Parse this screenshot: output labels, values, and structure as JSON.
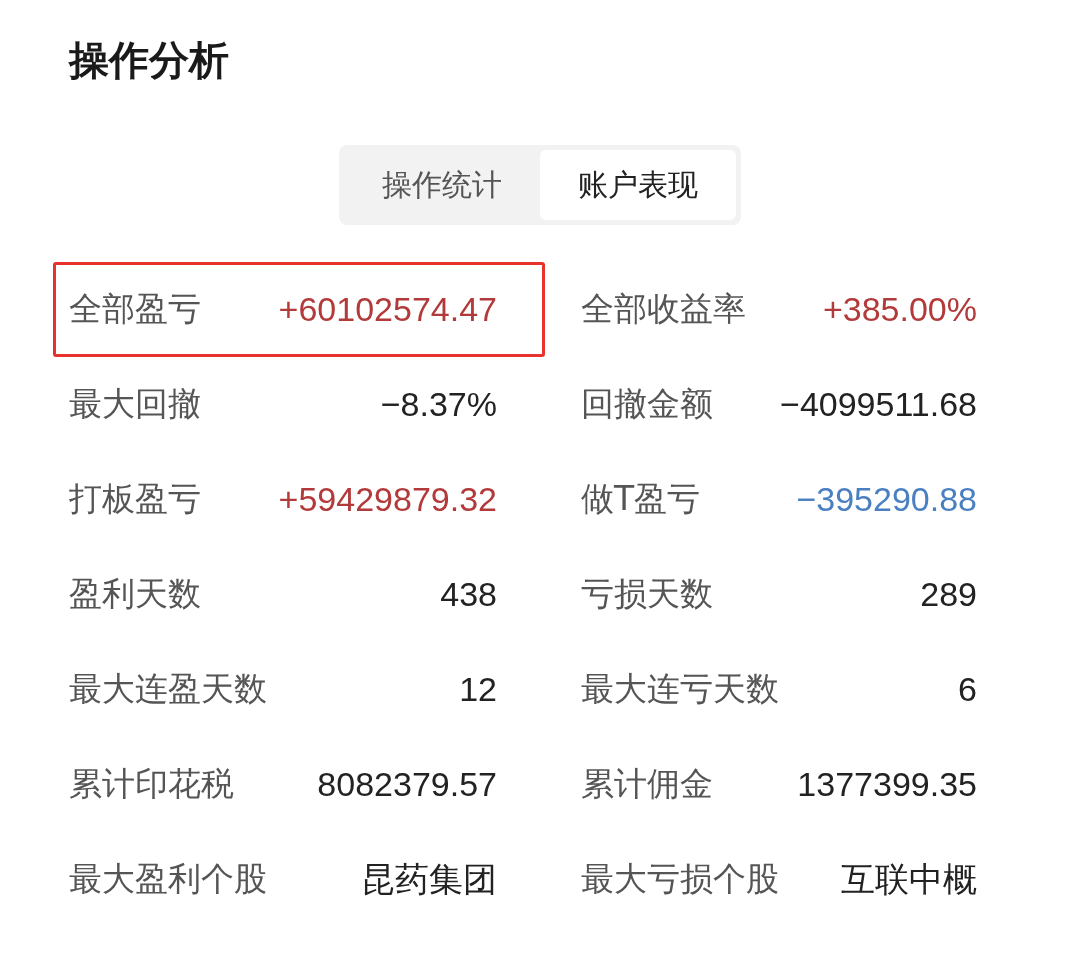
{
  "title": "操作分析",
  "tabs": [
    {
      "label": "操作统计",
      "selected": false
    },
    {
      "label": "账户表现",
      "selected": true
    }
  ],
  "stats": [
    {
      "label": "全部盈亏",
      "value": "+60102574.47",
      "color": "#b23a3a",
      "highlighted": true
    },
    {
      "label": "全部收益率",
      "value": "+385.00%",
      "color": "#b23a3a",
      "highlighted": false
    },
    {
      "label": "最大回撤",
      "value": "−8.37%",
      "color": "#222222",
      "highlighted": false
    },
    {
      "label": "回撤金额",
      "value": "−4099511.68",
      "color": "#222222",
      "highlighted": false
    },
    {
      "label": "打板盈亏",
      "value": "+59429879.32",
      "color": "#b23a3a",
      "highlighted": false
    },
    {
      "label": "做T盈亏",
      "value": "−395290.88",
      "color": "#4a7fc1",
      "highlighted": false
    },
    {
      "label": "盈利天数",
      "value": "438",
      "color": "#222222",
      "highlighted": false
    },
    {
      "label": "亏损天数",
      "value": "289",
      "color": "#222222",
      "highlighted": false
    },
    {
      "label": "最大连盈天数",
      "value": "12",
      "color": "#222222",
      "highlighted": false
    },
    {
      "label": "最大连亏天数",
      "value": "6",
      "color": "#222222",
      "highlighted": false
    },
    {
      "label": "累计印花税",
      "value": "8082379.57",
      "color": "#222222",
      "highlighted": false
    },
    {
      "label": "累计佣金",
      "value": "1377399.35",
      "color": "#222222",
      "highlighted": false
    },
    {
      "label": "最大盈利个股",
      "value": "昆药集团",
      "color": "#222222",
      "highlighted": false
    },
    {
      "label": "最大亏损个股",
      "value": "互联中概",
      "color": "#222222",
      "highlighted": false
    }
  ]
}
